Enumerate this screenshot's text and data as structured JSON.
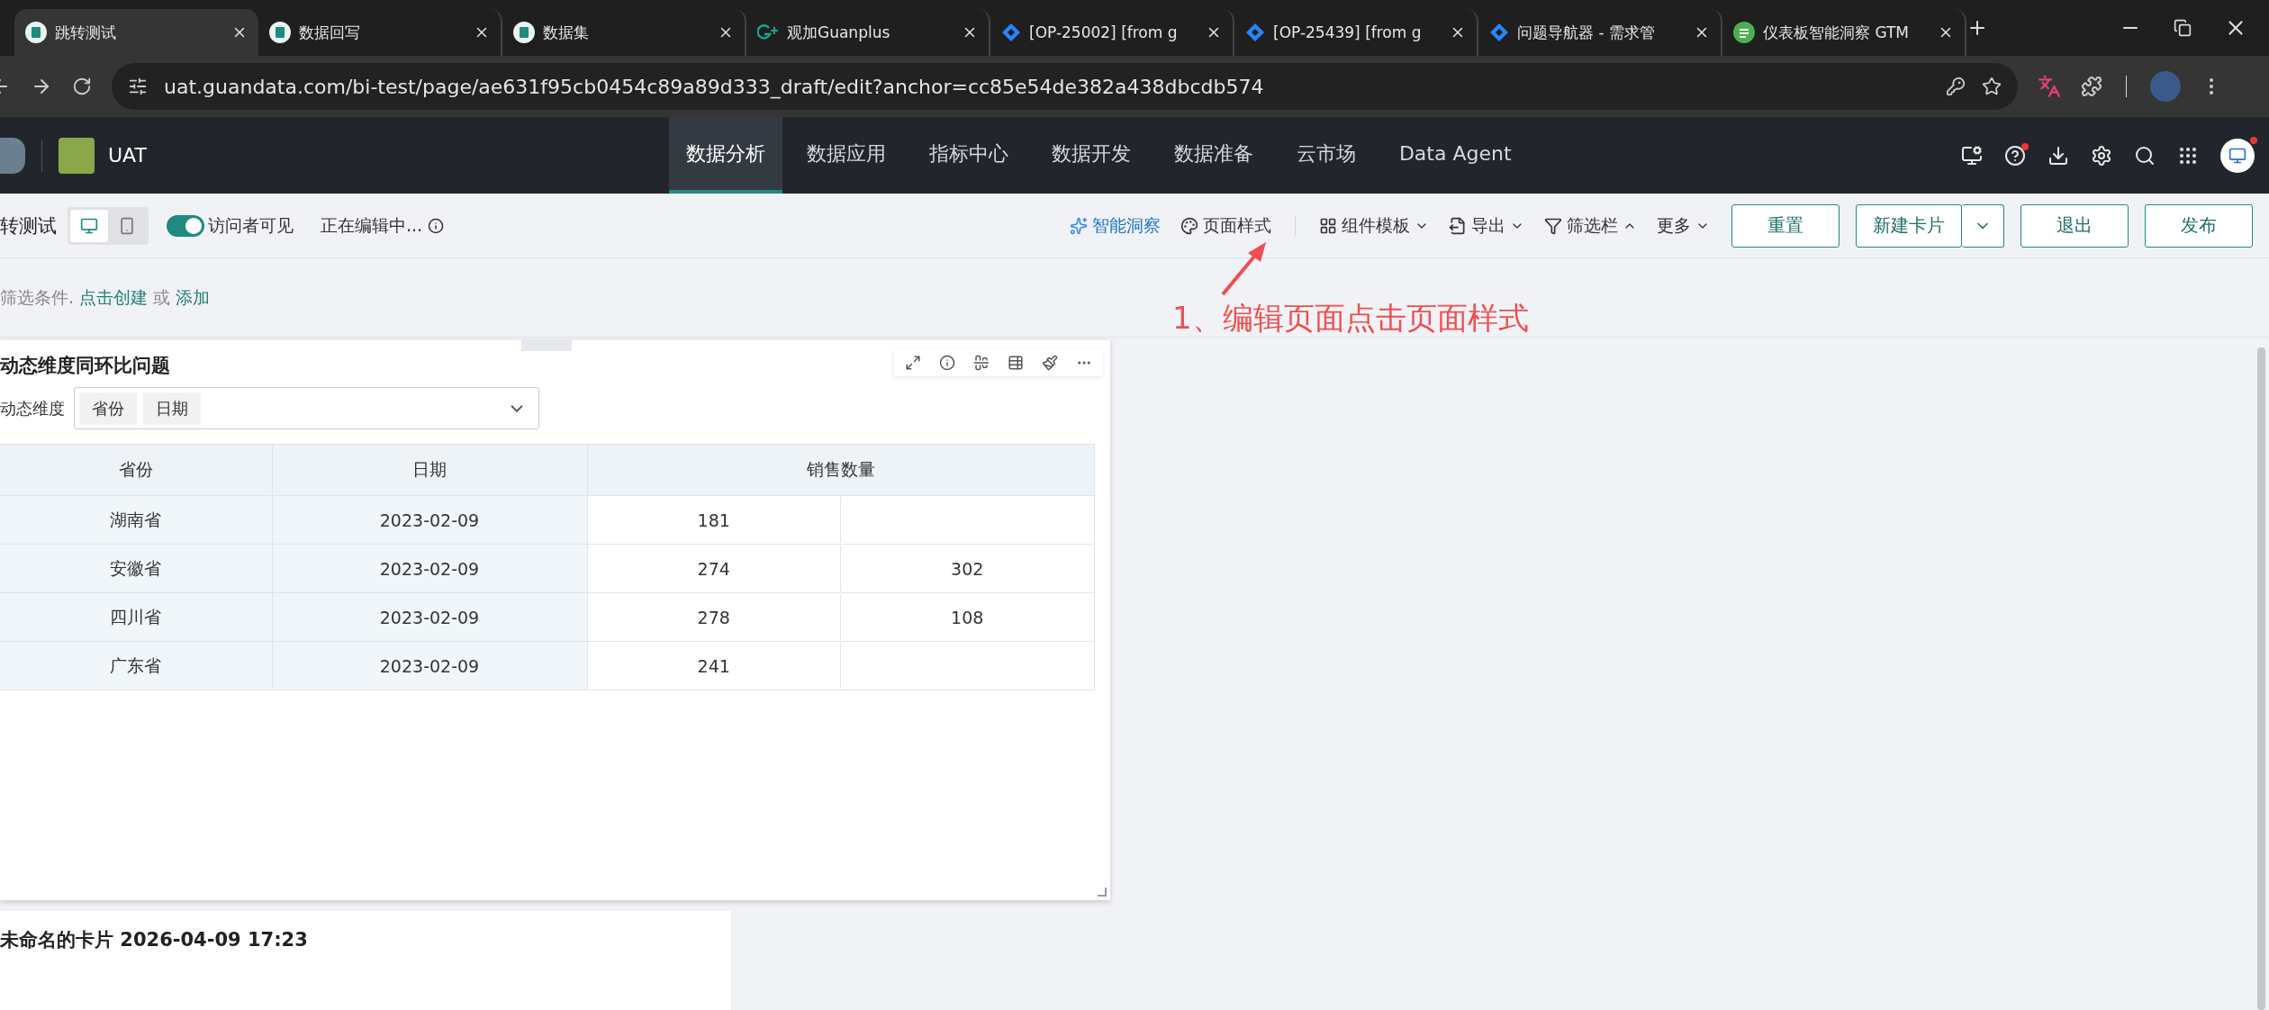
{
  "browser": {
    "tabs": [
      {
        "title": "跳转测试",
        "kind": "guandata",
        "selected": true
      },
      {
        "title": "数据回写",
        "kind": "guandata",
        "selected": false
      },
      {
        "title": "数据集",
        "kind": "guandata",
        "selected": false
      },
      {
        "title": "观加Guanplus",
        "kind": "gplus",
        "selected": false
      },
      {
        "title": "[OP-25002] [from g",
        "kind": "jira",
        "selected": false
      },
      {
        "title": "[OP-25439] [from g",
        "kind": "jira",
        "selected": false
      },
      {
        "title": "问题导航器 - 需求管",
        "kind": "jira",
        "selected": false
      },
      {
        "title": "仪表板智能洞察 GTM",
        "kind": "leaf",
        "selected": false
      }
    ],
    "url": "uat.guandata.com/bi-test/page/ae631f95cb0454c89a89d333_draft/edit?anchor=cc85e54de382a438dbcdb574"
  },
  "app_header": {
    "workspace": "UAT",
    "nav": [
      {
        "label": "数据分析",
        "selected": true
      },
      {
        "label": "数据应用",
        "selected": false
      },
      {
        "label": "指标中心",
        "selected": false
      },
      {
        "label": "数据开发",
        "selected": false
      },
      {
        "label": "数据准备",
        "selected": false
      },
      {
        "label": "云市场",
        "selected": false
      },
      {
        "label": "Data Agent",
        "selected": false
      }
    ],
    "help_badge": true,
    "avatar_badge": true
  },
  "toolbar": {
    "page_title": "转测试",
    "device_modes": [
      {
        "kind": "desktop",
        "selected": true
      },
      {
        "kind": "mobile",
        "selected": false
      }
    ],
    "visitor_visible": {
      "label": "访问者可见",
      "on": true
    },
    "edit_status": "正在编辑中...",
    "actions": [
      {
        "label": "智能洞察",
        "kind": "ai"
      },
      {
        "label": "页面样式",
        "kind": "style"
      },
      {
        "label": "组件模板",
        "kind": "template",
        "expanded": false
      },
      {
        "label": "导出",
        "kind": "export",
        "expanded": false
      },
      {
        "label": "筛选栏",
        "kind": "filter",
        "expanded": true
      },
      {
        "label": "更多",
        "kind": "more",
        "expanded": false
      }
    ],
    "buttons": [
      {
        "label": "重置",
        "kind": "plain"
      },
      {
        "label": "新建卡片",
        "kind": "split"
      },
      {
        "label": "退出",
        "kind": "plain"
      },
      {
        "label": "发布",
        "kind": "plain"
      }
    ]
  },
  "filter_bar": {
    "text": "筛选条件.",
    "create_link": "点击创建",
    "or": "或",
    "add_link": "添加"
  },
  "annotation": {
    "text": "1、编辑页面点击页面样式"
  },
  "card": {
    "title": "动态维度同环比问题",
    "dimension_label": "动态维度",
    "dimension_tags": [
      "省份",
      "日期"
    ],
    "table": {
      "columns": [
        "省份",
        "日期",
        "销售数量"
      ],
      "rows": [
        {
          "cells": [
            "湖南省",
            "2023-02-09"
          ],
          "sales": [
            "181"
          ]
        },
        {
          "cells": [
            "安徽省",
            "2023-02-09"
          ],
          "sales": [
            "274",
            "302"
          ]
        },
        {
          "cells": [
            "四川省",
            "2023-02-09"
          ],
          "sales": [
            "278",
            "108"
          ]
        },
        {
          "cells": [
            "广东省",
            "2023-02-09"
          ],
          "sales": [
            "241"
          ]
        }
      ]
    }
  },
  "second_card": {
    "title": "未命名的卡片 2026-04-09 17:23"
  }
}
